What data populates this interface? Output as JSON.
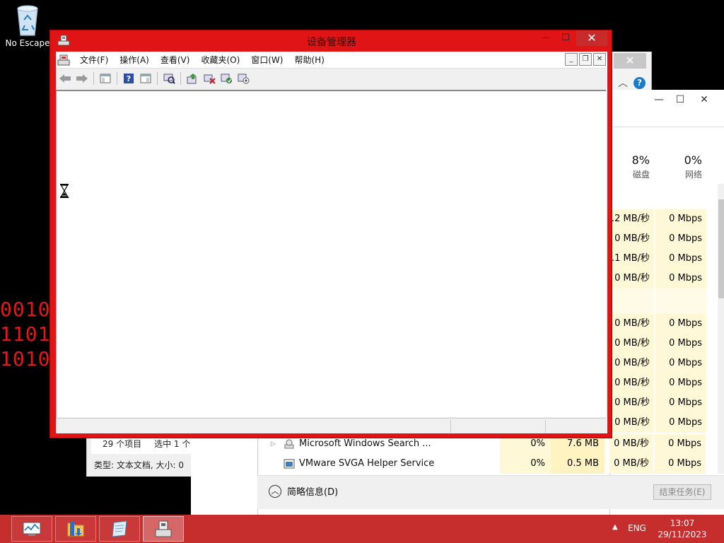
{
  "desktop": {
    "recycle_label": "No Escape",
    "binary_lines": [
      "0010",
      "1101",
      "1010"
    ]
  },
  "explorer": {
    "item_count": "29 个项目",
    "selected": "选中 1 个",
    "file_info": "类型: 文本文档, 大小: 0"
  },
  "task_manager": {
    "columns": {
      "disk_pct": "8%",
      "disk_label": "磁盘",
      "net_pct": "0%",
      "net_label": "网络"
    },
    "rows": [
      {
        "disk": ".2 MB/秒",
        "net": "0 Mbps"
      },
      {
        "disk": "0 MB/秒",
        "net": "0 Mbps"
      },
      {
        "disk": ".1 MB/秒",
        "net": "0 Mbps"
      },
      {
        "disk": "0 MB/秒",
        "net": "0 Mbps"
      },
      {
        "disk": "",
        "net": ""
      },
      {
        "disk": "0 MB/秒",
        "net": "0 Mbps"
      },
      {
        "disk": "0 MB/秒",
        "net": "0 Mbps"
      },
      {
        "disk": "0 MB/秒",
        "net": "0 Mbps"
      },
      {
        "disk": "0 MB/秒",
        "net": "0 Mbps"
      },
      {
        "disk": "0 MB/秒",
        "net": "0 Mbps"
      },
      {
        "disk": "0 MB/秒",
        "net": "0 Mbps"
      }
    ],
    "processes": [
      {
        "name": "Microsoft Windows Search ...",
        "cpu": "0%",
        "mem": "7.6 MB",
        "disk": "0 MB/秒",
        "net": "0 Mbps"
      },
      {
        "name": "VMware SVGA Helper Service",
        "cpu": "0%",
        "mem": "0.5 MB",
        "disk": "0 MB/秒",
        "net": "0 Mbps"
      }
    ],
    "fewer_details": "简略信息(D)",
    "end_task": "结束任务(E)"
  },
  "device_manager": {
    "title": "设备管理器",
    "menu": [
      "文件(F)",
      "操作(A)",
      "查看(V)",
      "收藏夹(O)",
      "窗口(W)",
      "帮助(H)"
    ],
    "toolbar_icons": [
      "back-icon",
      "forward-icon",
      "console-tree-icon",
      "help-icon",
      "action-pane-icon",
      "scan-hardware-icon",
      "update-driver-icon",
      "uninstall-icon",
      "enable-icon",
      "disable-icon"
    ]
  },
  "taskbar": {
    "apps": [
      "task-manager",
      "file-explorer",
      "notepad",
      "device-manager"
    ],
    "language": "ENG",
    "time": "13:07",
    "date": "29/11/2023"
  },
  "colors": {
    "accent_red": "#e01414",
    "taskbar_red": "#c62d2d",
    "tm_highlight": "#fff8d6"
  }
}
